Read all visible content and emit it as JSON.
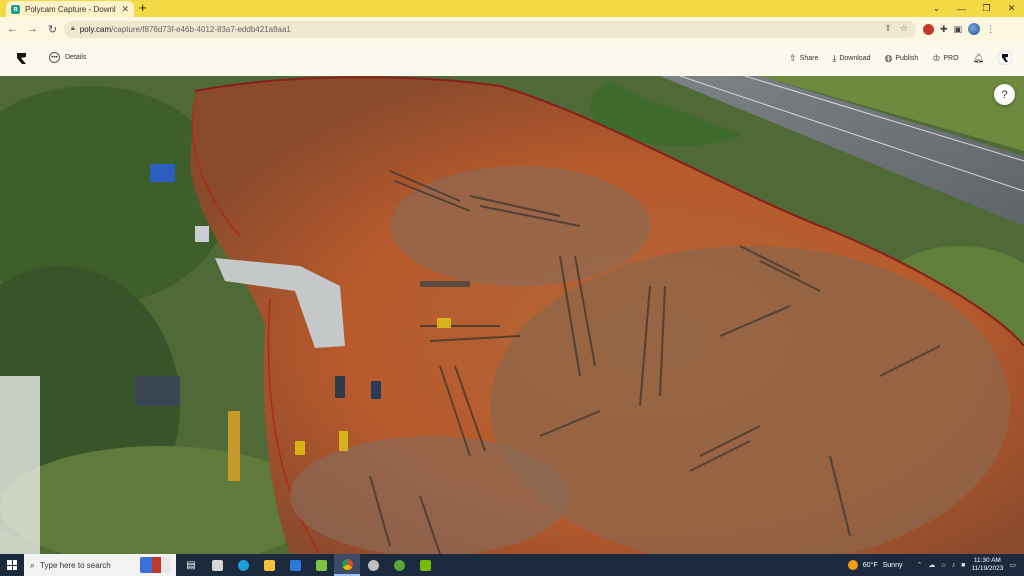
{
  "browser": {
    "tab_title": "Polycam Capture - Download F...",
    "tab_favicon": "polycam-favicon",
    "new_tab": "+",
    "url_host": "poly.cam",
    "url_path": "/capture/f876d73f-e46b-4012-83a7-eddb421a8aa1",
    "controls": {
      "chevron": "⌄",
      "minimize": "—",
      "restore": "❐",
      "close": "✕"
    }
  },
  "app_header": {
    "details_label": "Details",
    "share_label": "Share",
    "download_label": "Download",
    "publish_label": "Publish",
    "pro_label": "PRO"
  },
  "viewport": {
    "help_label": "?"
  },
  "taskbar": {
    "search_placeholder": "Type here to search",
    "weather_temp": "60°F",
    "weather_desc": "Sunny",
    "time": "11:30 AM",
    "date": "11/19/2023",
    "apps": [
      "task-view-icon",
      "app-icon",
      "edge-icon",
      "file-explorer-icon",
      "mail-icon",
      "notes-icon",
      "chrome-icon",
      "app-icon",
      "qgis-icon",
      "nvidia-icon"
    ]
  }
}
